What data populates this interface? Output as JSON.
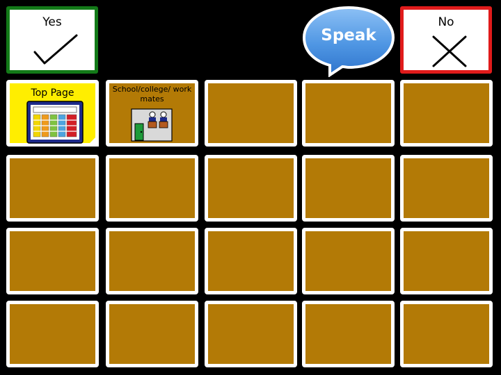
{
  "top_bar": {
    "yes_label": "Yes",
    "no_label": "No",
    "speak_label": "Speak"
  },
  "grid": {
    "cells": [
      {
        "label": "Top Page",
        "kind": "navigation"
      },
      {
        "label": "School/college/ work mates",
        "kind": "category"
      },
      {
        "label": "",
        "kind": "empty"
      },
      {
        "label": "",
        "kind": "empty"
      },
      {
        "label": "",
        "kind": "empty"
      },
      {
        "label": "",
        "kind": "empty"
      },
      {
        "label": "",
        "kind": "empty"
      },
      {
        "label": "",
        "kind": "empty"
      },
      {
        "label": "",
        "kind": "empty"
      },
      {
        "label": "",
        "kind": "empty"
      },
      {
        "label": "",
        "kind": "empty"
      },
      {
        "label": "",
        "kind": "empty"
      },
      {
        "label": "",
        "kind": "empty"
      },
      {
        "label": "",
        "kind": "empty"
      },
      {
        "label": "",
        "kind": "empty"
      },
      {
        "label": "",
        "kind": "empty"
      },
      {
        "label": "",
        "kind": "empty"
      },
      {
        "label": "",
        "kind": "empty"
      },
      {
        "label": "",
        "kind": "empty"
      },
      {
        "label": "",
        "kind": "empty"
      }
    ]
  },
  "colors": {
    "background": "#000000",
    "cell_fill": "#b37a06",
    "top_page_fill": "#ffee00",
    "yes_border": "#137a18",
    "no_border": "#e01b1b",
    "speak_fill": "#4f96e3"
  },
  "icons": [
    "checkmark-icon",
    "cross-icon",
    "speech-bubble-icon",
    "grid-page-icon",
    "classroom-icon"
  ]
}
